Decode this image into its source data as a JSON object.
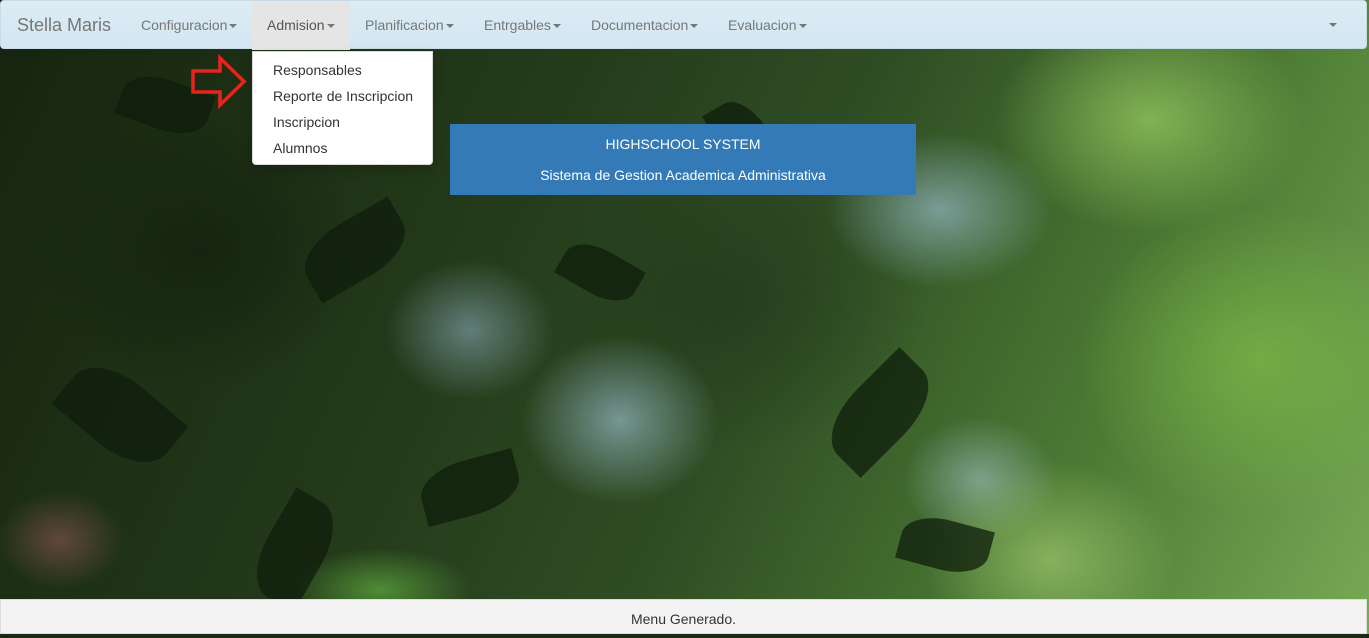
{
  "navbar": {
    "brand": "Stella Maris",
    "menus": [
      {
        "label": "Configuracion"
      },
      {
        "label": "Admision",
        "active": true
      },
      {
        "label": "Planificacion"
      },
      {
        "label": "Entrgables"
      },
      {
        "label": "Documentacion"
      },
      {
        "label": "Evaluacion"
      }
    ]
  },
  "dropdown": {
    "items": [
      "Responsables",
      "Reporte de Inscripcion",
      "Inscripcion",
      "Alumnos"
    ]
  },
  "banner": {
    "title": "HIGHSCHOOL SYSTEM",
    "subtitle": "Sistema de Gestion Academica Administrativa"
  },
  "footer": {
    "message": "Menu Generado."
  },
  "colors": {
    "navbar_bg": "#d9eaf4",
    "banner_bg": "#337ab7",
    "annotation_arrow": "#e8231e"
  },
  "icons": {
    "dropdown_caret": "caret-down-icon",
    "annotation": "arrow-right-icon"
  }
}
